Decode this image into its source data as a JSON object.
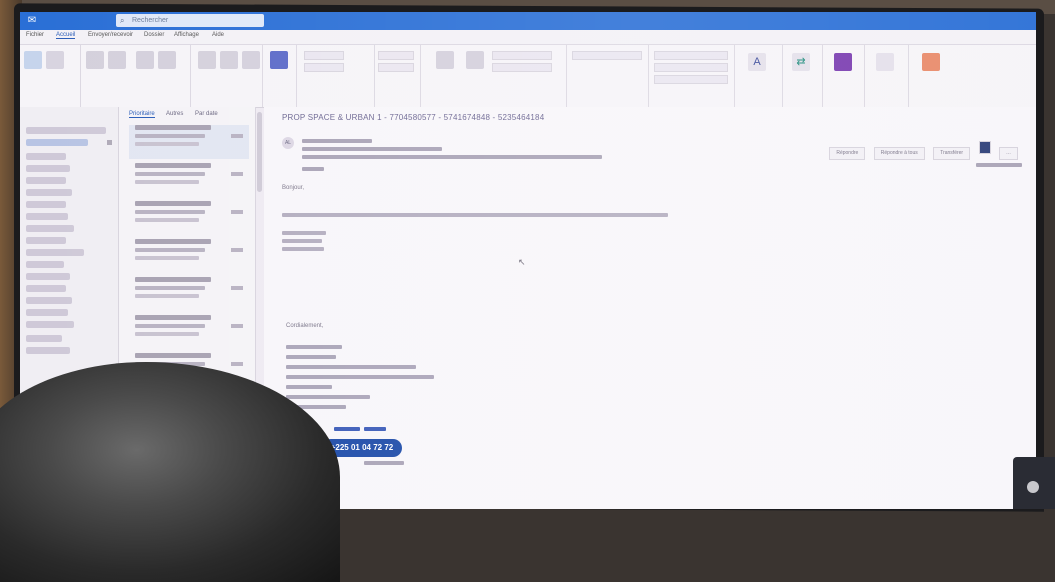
{
  "window": {
    "app_icon": "outlook-icon",
    "search_placeholder": "Rechercher"
  },
  "tabs": [
    "Fichier",
    "Accueil",
    "Envoyer/recevoir",
    "Dossier",
    "Affichage",
    "Aide"
  ],
  "message_list": {
    "tabs": [
      "Prioritaire",
      "Autres"
    ],
    "sort_label": "Par date"
  },
  "reading_pane": {
    "subject": "PROP SPACE & URBAN 1 - 7704580577 - 5741674848 - 5235464184",
    "avatar_initials": "AL",
    "actions": {
      "reply": "Répondre",
      "reply_all": "Répondre à tous",
      "forward": "Transférer"
    },
    "greeting": "Bonjour,",
    "sig_closing": "Cordialement,",
    "phone_badge": "+225 01 04 72 72"
  },
  "colors": {
    "titlebar": "#2a6fd6",
    "accent": "#2a5db8",
    "badge": "#1c4aa8"
  }
}
